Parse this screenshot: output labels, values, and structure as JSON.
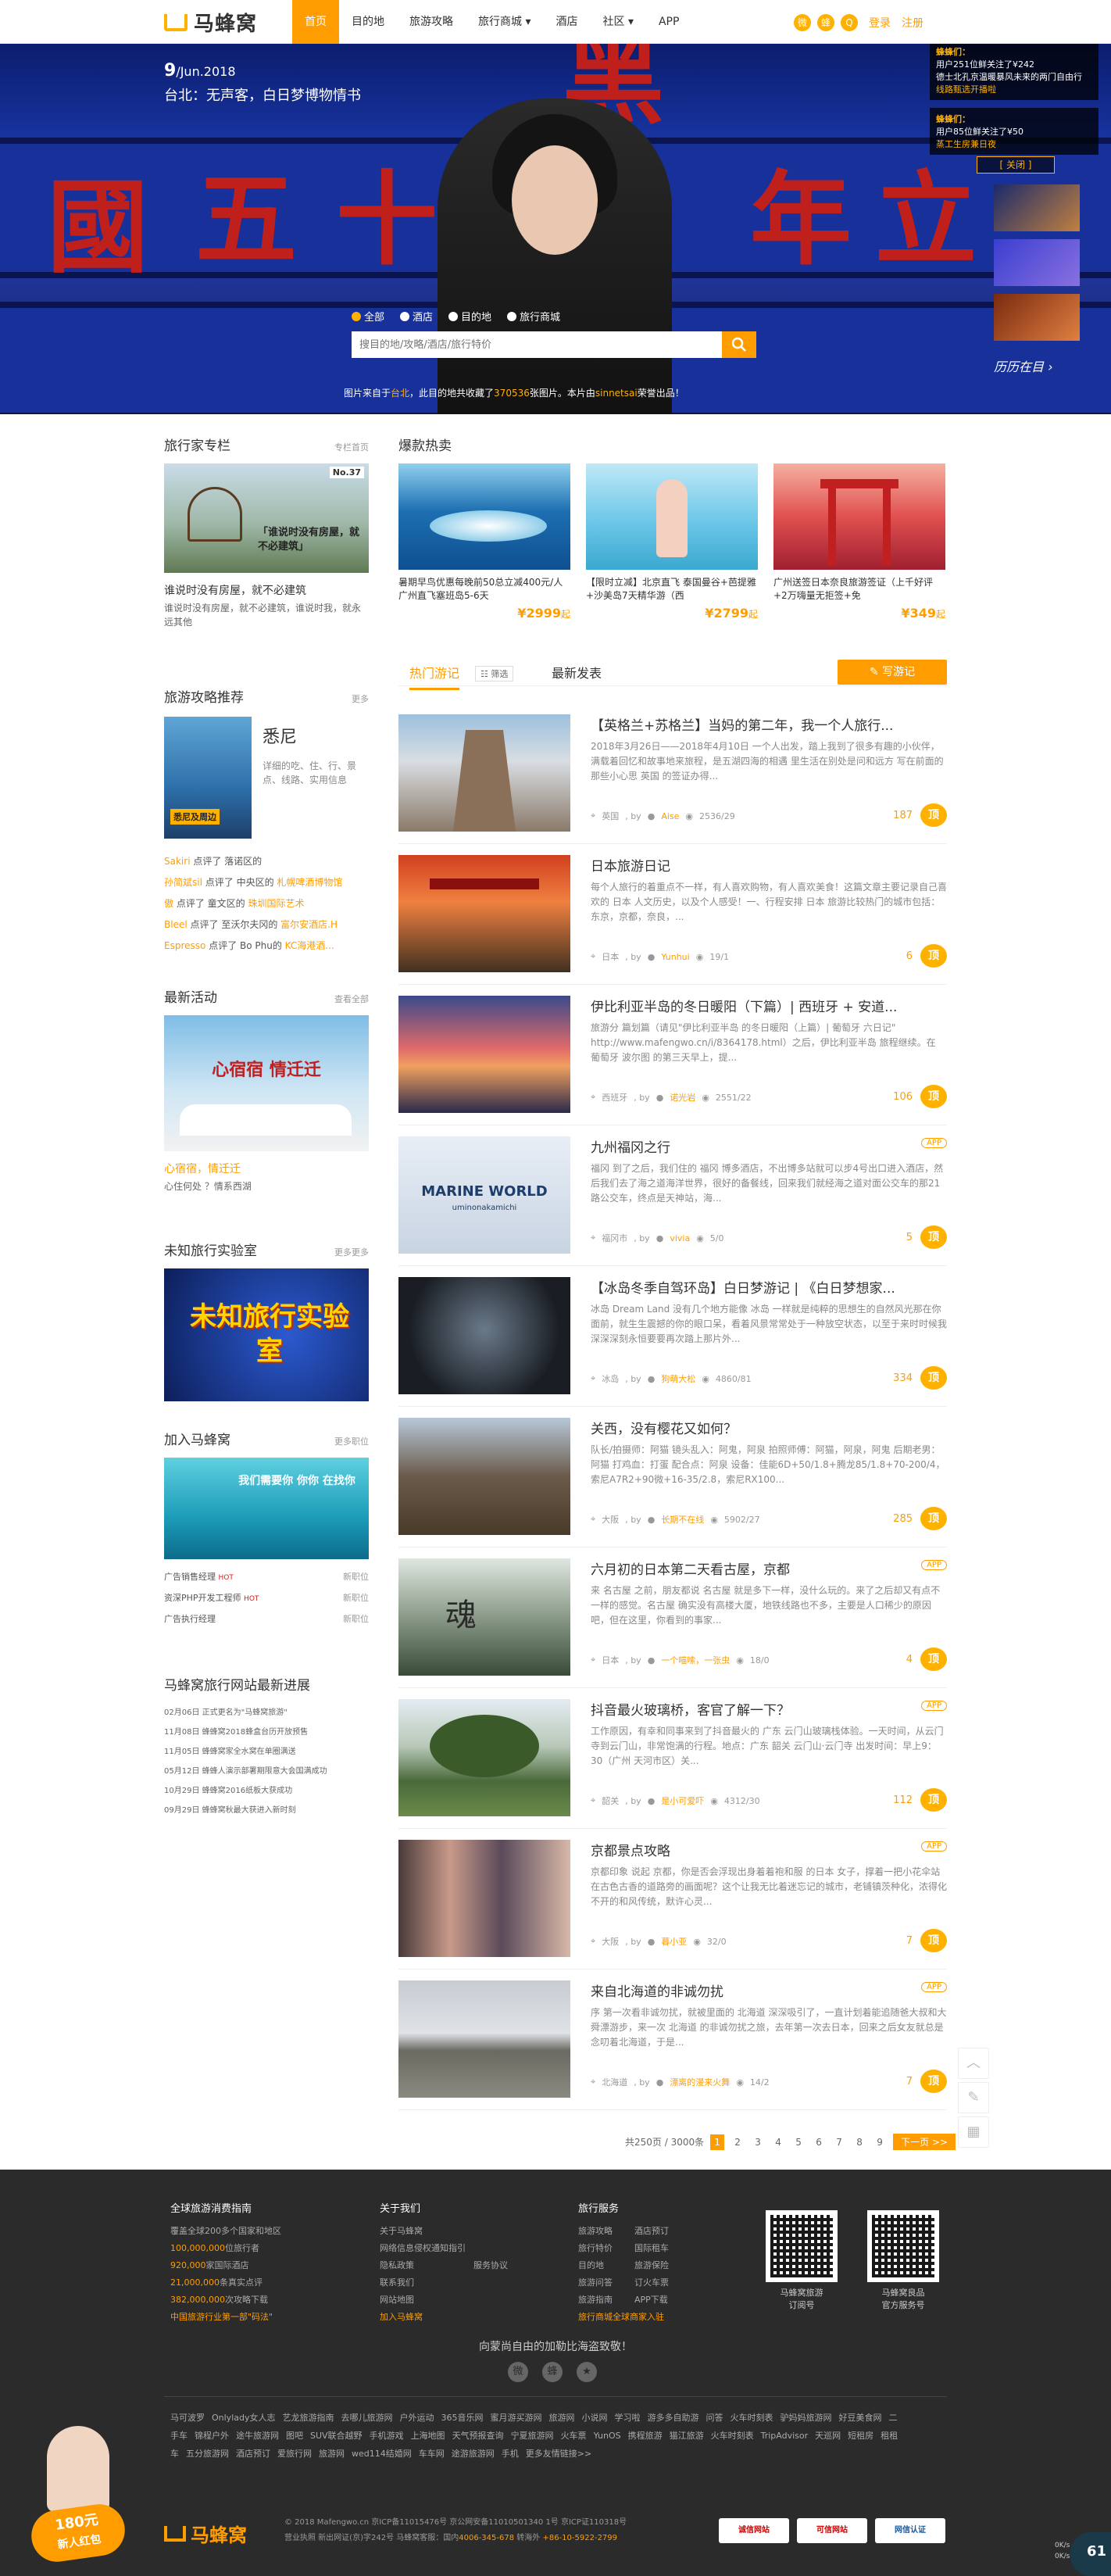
{
  "header": {
    "logo_text": "马蜂窝",
    "nav": [
      "首页",
      "目的地",
      "旅游攻略",
      "旅行商城",
      "酒店",
      "社区",
      "APP"
    ],
    "nav_carets": [
      "",
      "",
      "",
      "▾",
      "",
      "▾",
      ""
    ],
    "social_icons": [
      "微",
      "蜂",
      "Q"
    ],
    "login": "登录",
    "register": "注册"
  },
  "hero": {
    "date_day": "9",
    "date_rest": "/Jun.2018",
    "subtitle": "台北：无声客，白日梦博物情书",
    "search_tabs": [
      "全部",
      "酒店",
      "目的地",
      "旅行商城"
    ],
    "search_placeholder": "搜目的地/攻略/酒店/旅行特价",
    "credit_prefix": "图片来自于",
    "credit_place": "台北",
    "credit_mid": "，此目的地共收藏了",
    "credit_count": "370536",
    "credit_mid2": "张图片。本片由",
    "credit_author": "sinnetsai",
    "credit_suffix": "荣誉出品！",
    "notice1_title": "蜂蜂们：",
    "notice1_body": "用户251位鲜关注了¥242",
    "notice1_sub": "德士北孔京温暖暴风未来的两门自由行",
    "notice1_tail": "线路甄选开播啦",
    "notice2_title": "蜂蜂们：",
    "notice2_body": "用户85位鲜关注了¥50",
    "notice2_sub": "蒸工生房兼日夜",
    "close_label": "[ 关闭 ]",
    "history_label": "历历在目 ›"
  },
  "left": {
    "column": {
      "title": "旅行家专栏",
      "more": "专栏首页",
      "img_badge": "No.37",
      "img_caption": "「谁说时没有房屋，就不必建筑」",
      "article_title": "谁说时没有房屋，就不必建筑",
      "article_desc": "谁说时没有房屋，就不必建筑，谁说时我，就永远其他"
    },
    "guide": {
      "title": "旅游攻略推荐",
      "more": "更多",
      "city": "悉尼",
      "book_label": "悉尼及周边",
      "desc": "详细的吃、住、行、景点、线路、实用信息"
    },
    "comments": [
      {
        "user": "Sakiri",
        "text": "点评了 落诺区的"
      },
      {
        "user": "孙简斌sil",
        "text": "点评了 中央区的",
        "place": "札幌啤酒博物馆"
      },
      {
        "user": "傲",
        "text": "点评了 童文区的",
        "place": "珠圳国际艺术"
      },
      {
        "user": "Bleel",
        "text": "点评了 至沃尔夫冈的",
        "place": "富尔安酒店.H"
      },
      {
        "user": "Espresso",
        "text": "点评了 Bo Phu的",
        "place": "KC海港酒..."
      }
    ],
    "event": {
      "title": "最新活动",
      "more": "查看全部",
      "img_caption": "心宿宿 情迁迁",
      "name": "心宿宿，情迁迁",
      "sub": "心住何处 ？情系西湖"
    },
    "lab": {
      "title": "未知旅行实验室",
      "more": "更多更多",
      "img_text": "未知旅行实验室"
    },
    "join": {
      "title": "加入马蜂窝",
      "more": "更多职位",
      "img_text": "我们需要你 你你 在找你",
      "jobs": [
        {
          "name": "广告销售经理",
          "tag": "HOT",
          "loc": "新职位"
        },
        {
          "name": "资深PHP开发工程师",
          "tag": "HOT",
          "loc": "新职位"
        },
        {
          "name": "广告执行经理",
          "tag": "",
          "loc": "新职位"
        }
      ]
    },
    "news": {
      "title": "马蜂窝旅行网站最新进展",
      "items": [
        {
          "date": "02月06日",
          "text": "正式更名为\"马蜂窝旅游\""
        },
        {
          "date": "11月08日",
          "text": "蜂蜂窝2018蜂盒台历开放预售"
        },
        {
          "date": "11月05日",
          "text": "蜂蜂窝家全水窝在单圈满送"
        },
        {
          "date": "05月12日",
          "text": "蜂蜂人演示部署期限意大会国满成功"
        },
        {
          "date": "10月29日",
          "text": "蜂蜂窝2016纸板大获成功"
        },
        {
          "date": "09月29日",
          "text": "蜂蜂窝秋最大获进入新时刻"
        }
      ]
    }
  },
  "hot": {
    "title": "爆款热卖",
    "cards": [
      {
        "desc": "暑期早鸟优惠每晚前50总立减400元/人 广州直飞塞班岛5-6天",
        "price": "¥2999",
        "unit": "起"
      },
      {
        "desc": "【限时立减】北京直飞 泰国曼谷+芭提雅+沙美岛7天精华游（西",
        "price": "¥2799",
        "unit": "起"
      },
      {
        "desc": "广州送签日本奈良旅游签证（上千好评+2万嗨量无拒签+免",
        "price": "¥349",
        "unit": "起"
      }
    ]
  },
  "feed": {
    "tabs": [
      "热门游记",
      "最新发表"
    ],
    "filter_label": "☷ 筛选",
    "write_label": "✎ 写游记",
    "posts": [
      {
        "title": "【英格兰+苏格兰】当妈的第二年，我一个人旅行...",
        "abstract": "2018年3月26日——2018年4月10日 一个人出发，踏上我到了很多有趣的小伙伴，满载着回忆和故事地来旅程，是五湖四海的相遇 里生活在别处是问和远方 写在前面的那些小心思 英国 的签证办得...",
        "place": "英国",
        "author": "Aise",
        "views": "2536/29",
        "count": "187",
        "app": false
      },
      {
        "title": "日本旅游日记",
        "abstract": "每个人旅行的着重点不一样，有人喜欢购物，有人喜欢美食！这篇文章主要记录自己喜欢的 日本 人文历史，以及个人感受！一、行程安排 日本 旅游比较热门的城市包括：东京，京都，奈良，...",
        "place": "日本",
        "author": "Yunhui",
        "views": "19/1",
        "count": "6",
        "app": false
      },
      {
        "title": "伊比利亚半岛的冬日暖阳（下篇）| 西班牙 + 安道...",
        "abstract": "旅游分 篇划篇（请见\"伊比利亚半岛 的冬日暖阳（上篇）| 葡萄牙 六日记\" http://www.mafengwo.cn/i/8364178.html）之后，伊比利亚半岛 旅程继续。在 葡萄牙 波尔图 的第三天早上，提...",
        "place": "西班牙",
        "author": "诺光岩",
        "views": "2551/22",
        "count": "106",
        "app": false
      },
      {
        "title": "九州福冈之行",
        "abstract": "福冈 到了之后，我们住的 福冈 博多酒店，不出博多站就可以步4号出口进入酒店，然后我们去了海之道海洋世界，很好的备餐线，回来我们就经海之道对面公交车的那21路公交车，终点是天神站，海...",
        "place": "福冈市",
        "author": "vivia",
        "views": "5/0",
        "count": "5",
        "app": true
      },
      {
        "title": "【冰岛冬季自驾环岛】白日梦游记 | 《白日梦想家...",
        "abstract": "冰岛 Dream Land 没有几个地方能像 冰岛 一样就是纯粹的思想生的自然风光那在你面前，就生生震撼的你的眼口呆，看着风景常常处于一种放空状态，以至于来时时候我深深深刻永恒要要再次踏上那片外...",
        "place": "冰岛",
        "author": "狗萌大松",
        "views": "4860/81",
        "count": "334",
        "app": false
      },
      {
        "title": "关西，没有樱花又如何？",
        "abstract": "队长/拍摄师：阿猫 镜头乱入：阿鬼，阿泉 拍照师傅：阿猫，阿泉，阿鬼 后期老男：阿猫 打鸡血：打蛋 配合点：阿泉 设备：佳能6D+50/1.8+腾龙85/1.8+70-200/4，索尼A7R2+90微+16-35/2.8，索尼RX100...",
        "place": "大阪",
        "author": "长期不在线",
        "views": "5902/27",
        "count": "285",
        "app": false
      },
      {
        "title": "六月初的日本第二天看古屋，京都",
        "abstract": "来 名古屋 之前，朋友都说 名古屋 就是多下一样，没什么玩的。来了之后却又有点不一样的感觉。名古屋 确实没有高楼大厦，地铁线路也不多，主要是人口稀少的原因吧，但在这里，你看到的事家...",
        "place": "日本",
        "author": "一个喵嗦，一张虫",
        "views": "18/0",
        "count": "4",
        "app": true
      },
      {
        "title": "抖音最火玻璃桥，客官了解一下？",
        "abstract": "工作原因，有幸和同事来到了抖音最火的 广东 云门山玻璃栈体验。一天时间，从云门寺到云门山，非常饱满的行程。地点：广东 韶关 云门山·云门寺 出发时间：早上9：30（广州 天河市区）关...",
        "place": "韶关",
        "author": "是小可爱吓",
        "views": "4312/30",
        "count": "112",
        "app": true
      },
      {
        "title": "京都景点攻略",
        "abstract": "京都印象 说起 京都，你是否会浮现出身着着袍和服 的日本 女子，撑着一把小花伞站在古色古香的道路旁的画面呢？这个让我无比着迷忘记的城市，老铺镇茨种化，浓得化不开的和风传统，默许心灵...",
        "place": "大阪",
        "author": "暮小亚",
        "views": "32/0",
        "count": "7",
        "app": true
      },
      {
        "title": "来自北海道的非诚勿扰",
        "abstract": "序 第一次看非诚勿扰，就被里面的 北海道 深深吸引了，一直计划着能追随爸大叔和大舜漂游步，来一次 北海道 的非诚勿扰之旅，去年第一次去日本，回来之后女友就总是念叨着北海道，于是...",
        "place": "北海道",
        "author": "漂离的漫来火舞",
        "views": "14/2",
        "count": "7",
        "app": true
      }
    ],
    "pager": {
      "total": "共250页 / 3000条",
      "pages": [
        "1",
        "2",
        "3",
        "4",
        "5",
        "6",
        "7",
        "8",
        "9"
      ],
      "next": "下一页 >>"
    }
  },
  "footer": {
    "col1": {
      "title": "全球旅游消费指南",
      "lines": [
        {
          "hl": "",
          "text": "覆盖全球200多个国家和地区"
        },
        {
          "hl": "100,000,000",
          "text": "位旅行者"
        },
        {
          "hl": "920,000",
          "text": "家国际酒店"
        },
        {
          "hl": "21,000,000",
          "text": "条真实点评"
        },
        {
          "hl": "382,000,000",
          "text": "次攻略下载"
        },
        {
          "hl": "中国旅游行业第一部\"码法\"",
          "text": ""
        }
      ]
    },
    "col2": {
      "title": "关于我们",
      "left": [
        "关于马蜂窝",
        "网络信息侵权通知指引",
        "隐私政策",
        "联系我们",
        "网站地图",
        "加入马蜂窝"
      ],
      "right": [
        "",
        "",
        "服务协议",
        "",
        "",
        ""
      ]
    },
    "col3": {
      "title": "旅行服务",
      "left": [
        "旅游攻略",
        "旅行特价",
        "目的地",
        "旅游问答",
        "旅游指南",
        "旅行商城全球商家入驻"
      ],
      "right": [
        "酒店预订",
        "国际租车",
        "旅游保险",
        "订火车票",
        "APP下载",
        ""
      ]
    },
    "qr1_label": "马蜂窝旅游\n订阅号",
    "qr2_label": "马蜂窝良品\n官方服务号",
    "slogan": "向蒙尚自由的加勒比海盗致敬！",
    "social": [
      "微",
      "蜂",
      "★"
    ],
    "links": [
      "马可波罗",
      "Onlylady女人志",
      "艺龙旅游指南",
      "去哪儿旅游网",
      "户外运动",
      "365音乐网",
      "蜜月游买游网",
      "旅游网",
      "小说网",
      "学习啦",
      "游多多自助游",
      "问答",
      "火车时刻表",
      "驴妈妈旅游网",
      "好豆美食网",
      "二手车",
      "锦程户外",
      "途牛旅游网",
      "图吧",
      "SUV联合越野",
      "手机游戏",
      "上海地图",
      "天气预报查询",
      "宁夏旅游网",
      "火车票",
      "YunOS",
      "携程旅游",
      "猫江旅游",
      "火车时刻表",
      "TripAdvisor",
      "天巡网",
      "短租房",
      "租租车",
      "五分旅游网",
      "酒店预订",
      "爱旅行网",
      "旅游网",
      "wed114结婚网",
      "车车网",
      "途游旅游网",
      "手机",
      "更多友情链接>>"
    ],
    "logo_text": "马蜂窝",
    "copy1": "© 2018 Mafengwo.cn 京ICP备11015476号 京公网安备11010501340 1号 京ICP证110318号",
    "copy2_prefix": "营业执照 新出网证(京)字242号 马蜂窝客服：国内",
    "copy2_phone1": "4006-345-678",
    "copy2_mid": "转海外",
    "copy2_phone2": "+86-10-5922-2799",
    "badges": [
      "诚信网站",
      "可信网站",
      "网信认证"
    ],
    "promo_text1": "180元",
    "promo_text2": "新人红包",
    "speed_top": "0K/s\n0K/s",
    "speed_num": "61"
  },
  "colors": {
    "accent": "#ff9d00",
    "footer_bg": "#2b2b2b",
    "hero_blue": "#1a37a8"
  }
}
